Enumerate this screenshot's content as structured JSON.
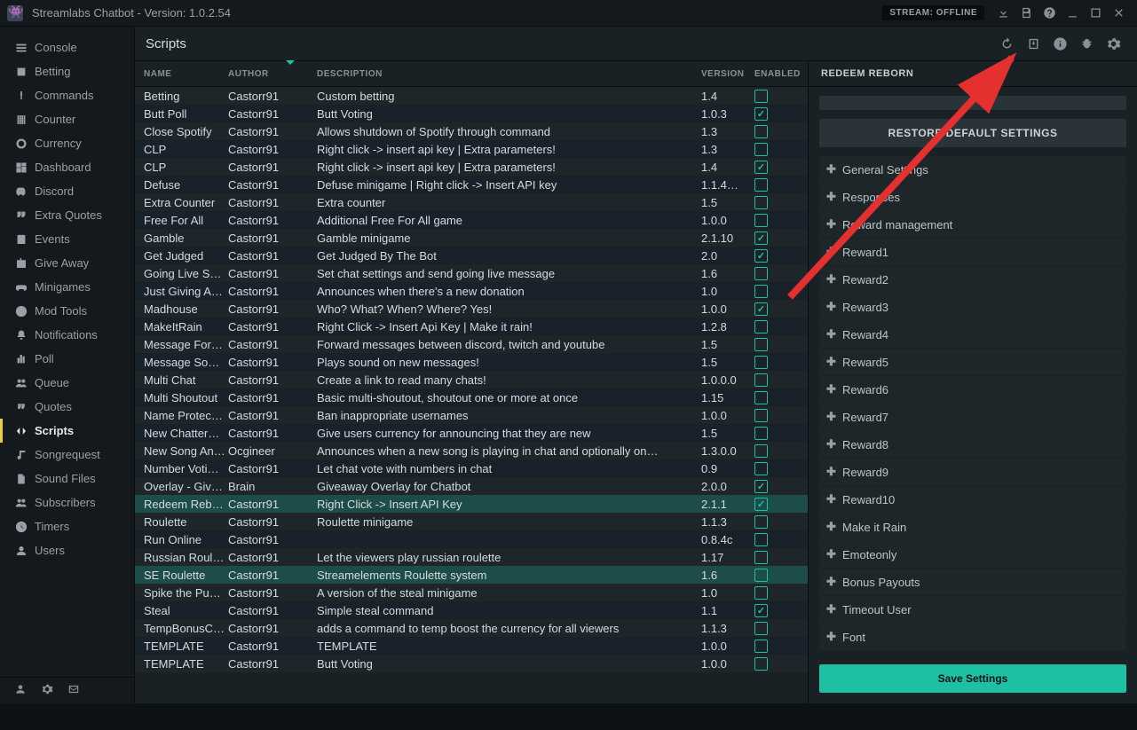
{
  "app": {
    "title": "Streamlabs Chatbot  - Version: 1.0.2.54",
    "stream_status": "STREAM: OFFLINE"
  },
  "sidebar": {
    "items": [
      {
        "icon": "bars",
        "label": "Console"
      },
      {
        "icon": "dice",
        "label": "Betting"
      },
      {
        "icon": "exclaim",
        "label": "Commands"
      },
      {
        "icon": "tally",
        "label": "Counter"
      },
      {
        "icon": "coin",
        "label": "Currency"
      },
      {
        "icon": "dash",
        "label": "Dashboard"
      },
      {
        "icon": "discord",
        "label": "Discord"
      },
      {
        "icon": "quotes",
        "label": "Extra Quotes"
      },
      {
        "icon": "cal",
        "label": "Events"
      },
      {
        "icon": "gift",
        "label": "Give Away"
      },
      {
        "icon": "game",
        "label": "Minigames"
      },
      {
        "icon": "ban",
        "label": "Mod Tools"
      },
      {
        "icon": "bell",
        "label": "Notifications"
      },
      {
        "icon": "poll",
        "label": "Poll"
      },
      {
        "icon": "users",
        "label": "Queue"
      },
      {
        "icon": "quote",
        "label": "Quotes"
      },
      {
        "icon": "code",
        "label": "Scripts"
      },
      {
        "icon": "music",
        "label": "Songrequest"
      },
      {
        "icon": "file",
        "label": "Sound Files"
      },
      {
        "icon": "users",
        "label": "Subscribers"
      },
      {
        "icon": "clock",
        "label": "Timers"
      },
      {
        "icon": "user",
        "label": "Users"
      }
    ],
    "active_index": 16
  },
  "page": {
    "title": "Scripts"
  },
  "columns": {
    "name": "NAME",
    "author": "AUTHOR",
    "desc": "DESCRIPTION",
    "version": "VERSION",
    "enabled": "ENABLED"
  },
  "scripts": [
    {
      "name": "Betting",
      "author": "Castorr91",
      "desc": "Custom betting",
      "ver": "1.4",
      "on": false
    },
    {
      "name": "Butt Poll",
      "author": "Castorr91",
      "desc": "Butt Voting",
      "ver": "1.0.3",
      "on": true
    },
    {
      "name": "Close Spotify",
      "author": "Castorr91",
      "desc": "Allows shutdown of Spotify through command",
      "ver": "1.3",
      "on": false
    },
    {
      "name": "CLP",
      "author": "Castorr91",
      "desc": "Right click -> insert api key | Extra parameters!",
      "ver": "1.3",
      "on": false
    },
    {
      "name": "CLP",
      "author": "Castorr91",
      "desc": "Right click -> insert api key | Extra parameters!",
      "ver": "1.4",
      "on": true
    },
    {
      "name": "Defuse",
      "author": "Castorr91",
      "desc": "Defuse minigame | Right click -> Insert API key",
      "ver": "1.1.4…",
      "on": false
    },
    {
      "name": "Extra Counter",
      "author": "Castorr91",
      "desc": "Extra counter",
      "ver": "1.5",
      "on": false
    },
    {
      "name": "Free For All",
      "author": "Castorr91",
      "desc": "Additional Free For All game",
      "ver": "1.0.0",
      "on": false
    },
    {
      "name": "Gamble",
      "author": "Castorr91",
      "desc": "Gamble minigame",
      "ver": "2.1.10",
      "on": true
    },
    {
      "name": "Get Judged",
      "author": "Castorr91",
      "desc": "Get Judged By The Bot",
      "ver": "2.0",
      "on": true
    },
    {
      "name": "Going Live S…",
      "author": "Castorr91",
      "desc": "Set chat settings and send going live message",
      "ver": "1.6",
      "on": false
    },
    {
      "name": "Just Giving A…",
      "author": "Castorr91",
      "desc": "Announces when there's a new donation",
      "ver": "1.0",
      "on": false
    },
    {
      "name": "Madhouse",
      "author": "Castorr91",
      "desc": "Who? What? When? Where? Yes!",
      "ver": "1.0.0",
      "on": true
    },
    {
      "name": "MakeItRain",
      "author": "Castorr91",
      "desc": "Right Click -> Insert Api Key | Make it rain!",
      "ver": "1.2.8",
      "on": false
    },
    {
      "name": "Message For…",
      "author": "Castorr91",
      "desc": "Forward messages between discord, twitch and youtube",
      "ver": "1.5",
      "on": false
    },
    {
      "name": "Message So…",
      "author": "Castorr91",
      "desc": "Plays sound on new messages!",
      "ver": "1.5",
      "on": false
    },
    {
      "name": "Multi Chat",
      "author": "Castorr91",
      "desc": "Create a link to read many chats!",
      "ver": "1.0.0.0",
      "on": false
    },
    {
      "name": "Multi Shoutout",
      "author": "Castorr91",
      "desc": "Basic multi-shoutout, shoutout one or more at once",
      "ver": "1.15",
      "on": false
    },
    {
      "name": "Name Protec…",
      "author": "Castorr91",
      "desc": "Ban inappropriate usernames",
      "ver": "1.0.0",
      "on": false
    },
    {
      "name": "New Chatter…",
      "author": "Castorr91",
      "desc": "Give users currency for announcing that they are new",
      "ver": "1.5",
      "on": false
    },
    {
      "name": "New Song An…",
      "author": "Ocgineer",
      "desc": "Announces when a new song is playing in chat and optionally on…",
      "ver": "1.3.0.0",
      "on": false
    },
    {
      "name": "Number Voti…",
      "author": "Castorr91",
      "desc": "Let chat vote with numbers in chat",
      "ver": "0.9",
      "on": false
    },
    {
      "name": "Overlay - Give…",
      "author": "Brain",
      "desc": "Giveaway Overlay for Chatbot",
      "ver": "2.0.0",
      "on": true
    },
    {
      "name": "Redeem Reb…",
      "author": "Castorr91",
      "desc": "Right Click -> Insert API Key",
      "ver": "2.1.1",
      "on": true,
      "sel": true
    },
    {
      "name": "Roulette",
      "author": "Castorr91",
      "desc": "Roulette minigame",
      "ver": "1.1.3",
      "on": false
    },
    {
      "name": "Run Online",
      "author": "Castorr91",
      "desc": "",
      "ver": "0.8.4c",
      "on": false
    },
    {
      "name": "Russian Roul…",
      "author": "Castorr91",
      "desc": "Let the viewers play russian roulette",
      "ver": "1.17",
      "on": false
    },
    {
      "name": "SE Roulette",
      "author": "Castorr91",
      "desc": "Streamelements Roulette system",
      "ver": "1.6",
      "on": false,
      "sel": true
    },
    {
      "name": "Spike the Pu…",
      "author": "Castorr91",
      "desc": "A version of the steal minigame",
      "ver": "1.0",
      "on": false
    },
    {
      "name": "Steal",
      "author": "Castorr91",
      "desc": "Simple steal command",
      "ver": "1.1",
      "on": true
    },
    {
      "name": "TempBonusC…",
      "author": "Castorr91",
      "desc": "adds a command to temp boost the currency for all viewers",
      "ver": "1.1.3",
      "on": false
    },
    {
      "name": "TEMPLATE",
      "author": "Castorr91",
      "desc": "TEMPLATE",
      "ver": "1.0.0",
      "on": false
    },
    {
      "name": "TEMPLATE",
      "author": "Castorr91",
      "desc": "Butt Voting",
      "ver": "1.0.0",
      "on": false
    }
  ],
  "config": {
    "title": "REDEEM REBORN",
    "restore": "RESTORE DEFAULT SETTINGS",
    "sections": [
      "General Settings",
      "Responses",
      "Reward management",
      "Reward1",
      "Reward2",
      "Reward3",
      "Reward4",
      "Reward5",
      "Reward6",
      "Reward7",
      "Reward8",
      "Reward9",
      "Reward10",
      "Make it Rain",
      "Emoteonly",
      "Bonus Payouts",
      "Timeout User",
      "Font"
    ],
    "save": "Save Settings"
  }
}
